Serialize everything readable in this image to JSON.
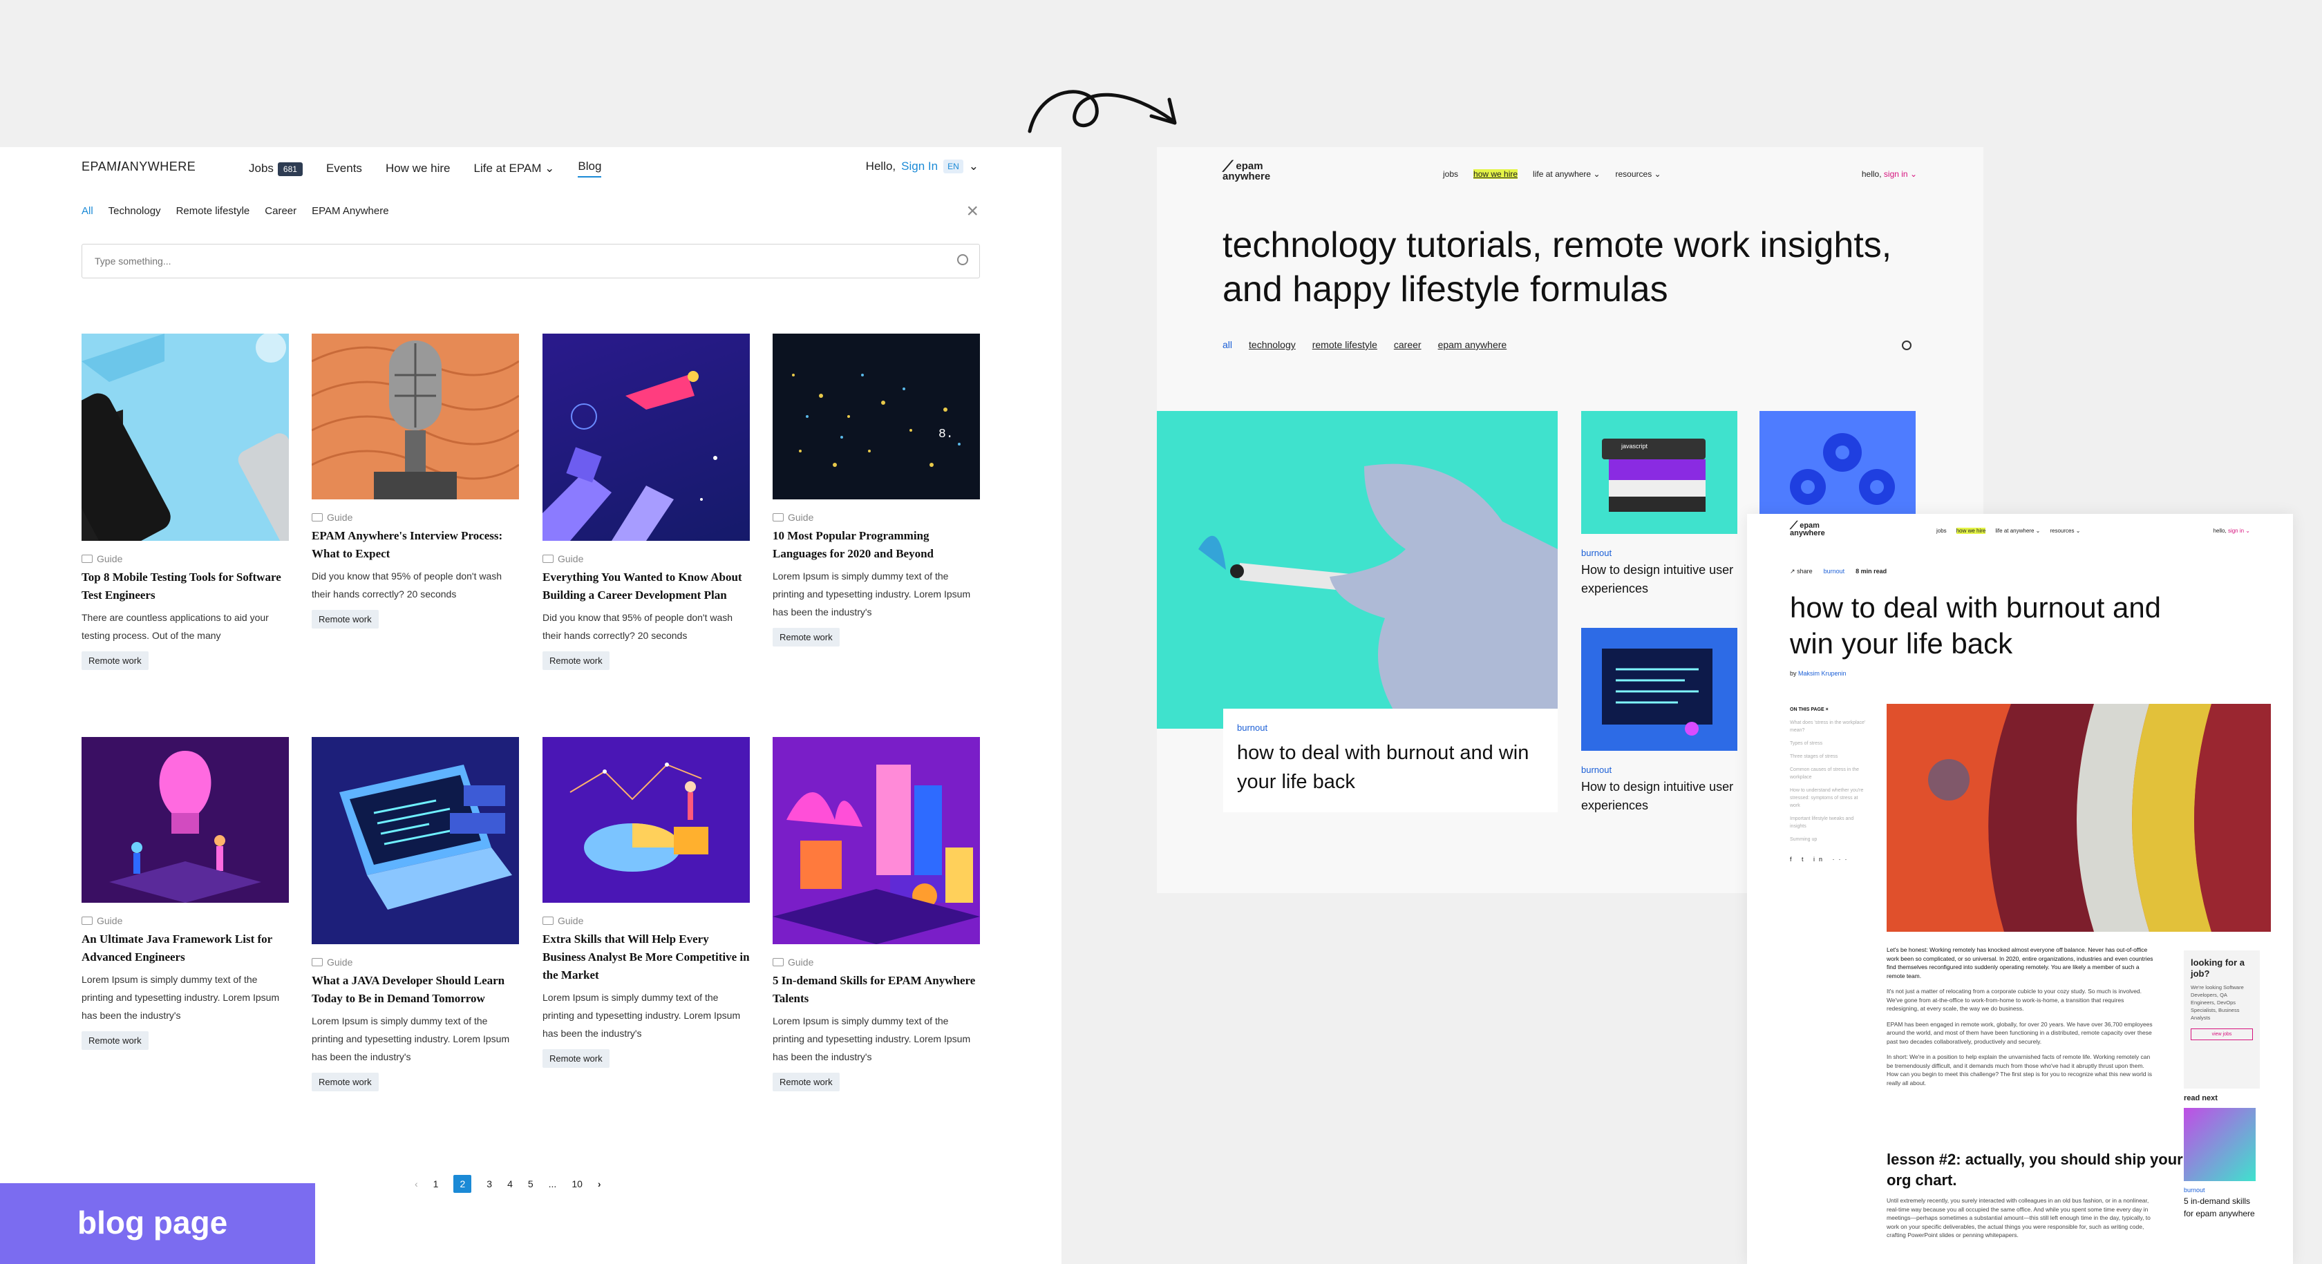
{
  "arrow": {
    "icon": "curly-arrow-icon"
  },
  "old_blog": {
    "logo": {
      "brand": "EPAM",
      "slash": "/",
      "product": "ANYWHERE"
    },
    "nav": {
      "jobs": "Jobs",
      "jobs_count": "681",
      "events": "Events",
      "how_we_hire": "How we hire",
      "life_at_epam": "Life at EPAM",
      "blog": "Blog"
    },
    "user": {
      "greeting": "Hello,",
      "sign_in": "Sign In",
      "lang": "EN"
    },
    "filters": [
      "All",
      "Technology",
      "Remote lifestyle",
      "Career",
      "EPAM Anywhere"
    ],
    "search": {
      "placeholder": "Type something..."
    },
    "cards": [
      {
        "tag": "Guide",
        "title": "Top 8 Mobile Testing Tools for Software Test Engineers",
        "excerpt": "There are countless applications to aid your testing process. Out of the many",
        "chip": "Remote work"
      },
      {
        "tag": "Guide",
        "title": "EPAM Anywhere's Interview Process: What to Expect",
        "excerpt": "Did you know that 95% of people don't wash their hands correctly? 20 seconds",
        "chip": "Remote work"
      },
      {
        "tag": "Guide",
        "title": "Everything You Wanted to Know About Building a Career Development Plan",
        "excerpt": "Did you know that 95% of people don't wash their hands correctly? 20 seconds",
        "chip": "Remote work"
      },
      {
        "tag": "Guide",
        "title": "10 Most Popular Programming Languages for 2020 and Beyond",
        "excerpt": "Lorem Ipsum is simply dummy text of the printing and typesetting industry. Lorem Ipsum has been the industry's",
        "chip": "Remote work"
      },
      {
        "tag": "Guide",
        "title": "An Ultimate Java Framework List for Advanced Engineers",
        "excerpt": "Lorem Ipsum is simply dummy text of the printing and typesetting industry. Lorem Ipsum has been the industry's",
        "chip": "Remote work"
      },
      {
        "tag": "Guide",
        "title": "What a JAVA Developer Should Learn Today to Be in Demand Tomorrow",
        "excerpt": "Lorem Ipsum is simply dummy text of the printing and typesetting industry. Lorem Ipsum has been the industry's",
        "chip": "Remote work"
      },
      {
        "tag": "Guide",
        "title": "Extra Skills that Will Help Every Business Analyst Be More Competitive in the Market",
        "excerpt": "Lorem Ipsum is simply dummy text of the printing and typesetting industry. Lorem Ipsum has been the industry's",
        "chip": "Remote work"
      },
      {
        "tag": "Guide",
        "title": "5 In-demand Skills for EPAM Anywhere Talents",
        "excerpt": "Lorem Ipsum is simply dummy text of the printing and typesetting industry. Lorem Ipsum has been the industry's",
        "chip": "Remote work"
      }
    ],
    "pagination": {
      "prev": "‹",
      "pages": [
        "1",
        "2",
        "3",
        "4",
        "5",
        "...",
        "10"
      ],
      "current": "2",
      "next": "›"
    }
  },
  "label_badge": "blog page",
  "new_blog": {
    "logo": {
      "line1": "epam",
      "line2": "anywhere"
    },
    "nav": {
      "jobs": "jobs",
      "how_we_hire": "how we hire",
      "life": "life at anywhere",
      "resources": "resources"
    },
    "user": {
      "greeting": "hello,",
      "sign_in": "sign in"
    },
    "headline": "technology tutorials, remote work insights, and happy lifestyle formulas",
    "filters": [
      "all",
      "technology",
      "remote lifestyle",
      "career",
      "epam anywhere"
    ],
    "hero": {
      "category": "burnout",
      "title": "how to deal with burnout and win your life back"
    },
    "small_cards": [
      {
        "category": "burnout",
        "title": "How to design intuitive user experiences",
        "image_label": "javascript"
      },
      {
        "category": "burnout",
        "title": "How to design intuitive user experiences"
      }
    ]
  },
  "article": {
    "logo": {
      "line1": "epam",
      "line2": "anywhere"
    },
    "nav": {
      "jobs": "jobs",
      "how_we_hire": "how we hire",
      "life": "life at anywhere",
      "resources": "resources"
    },
    "user": {
      "greeting": "hello,",
      "sign_in": "sign in"
    },
    "meta": {
      "share": "share",
      "category": "burnout",
      "read_time": "8 min read"
    },
    "title": "how to deal with burnout and win your life back",
    "byline": {
      "by": "by",
      "author": "Maksim Krupenin"
    },
    "toc": {
      "heading": "ON THIS PAGE",
      "items": [
        "What does 'stress in the workplace' mean?",
        "Types of stress",
        "Three stages of stress",
        "Common causes of stress in the workplace",
        "How to understand whether you're stressed: symptoms of stress at work",
        "Important lifestyle tweaks and insights",
        "Summing up"
      ]
    },
    "body": [
      "Let's be honest: Working remotely has knocked almost everyone off balance. Never has out-of-office work been so complicated, or so universal. In 2020, entire organizations, industries and even countries find themselves reconfigured into suddenly operating remotely. You are likely a member of such a remote team.",
      "It's not just a matter of relocating from a corporate cubicle to your cozy study. So much is involved. We've gone from at-the-office to work-from-home to work-is-home, a transition that requires redesigning, at every scale, the way we do business.",
      "EPAM has been engaged in remote work, globally, for over 20 years. We have over 36,700 employees around the world, and most of them have been functioning in a distributed, remote capacity over these past two decades collaboratively, productively and securely.",
      "In short: We're in a position to help explain the unvarnished facts of remote life. Working remotely can be tremendously difficult, and it demands much from those who've had it abruptly thrust upon them. How can you begin to meet this challenge? The first step is for you to recognize what this new world is really all about."
    ],
    "lesson_heading": "lesson #2: actually, you should ship your org chart.",
    "body2": "Until extremely recently, you surely interacted with colleagues in an old bus fashion, or in a nonlinear, real-time way because you all occupied the same office. And while you spent some time every day in meetings—perhaps sometimes a substantial amount—this still left enough time in the day, typically, to work on your specific deliverables, the actual things you were responsible for, such as writing code, crafting PowerPoint slides or penning whitepapers.",
    "sidebar": {
      "heading": "looking for a job?",
      "text": "We're looking Software Developers, QA Engineers, DevOps Specialists, Business Analysts",
      "button": "view jobs"
    },
    "read_next": {
      "heading": "read next",
      "category": "burnout",
      "title": "5 in-demand skills for epam anywhere"
    }
  }
}
